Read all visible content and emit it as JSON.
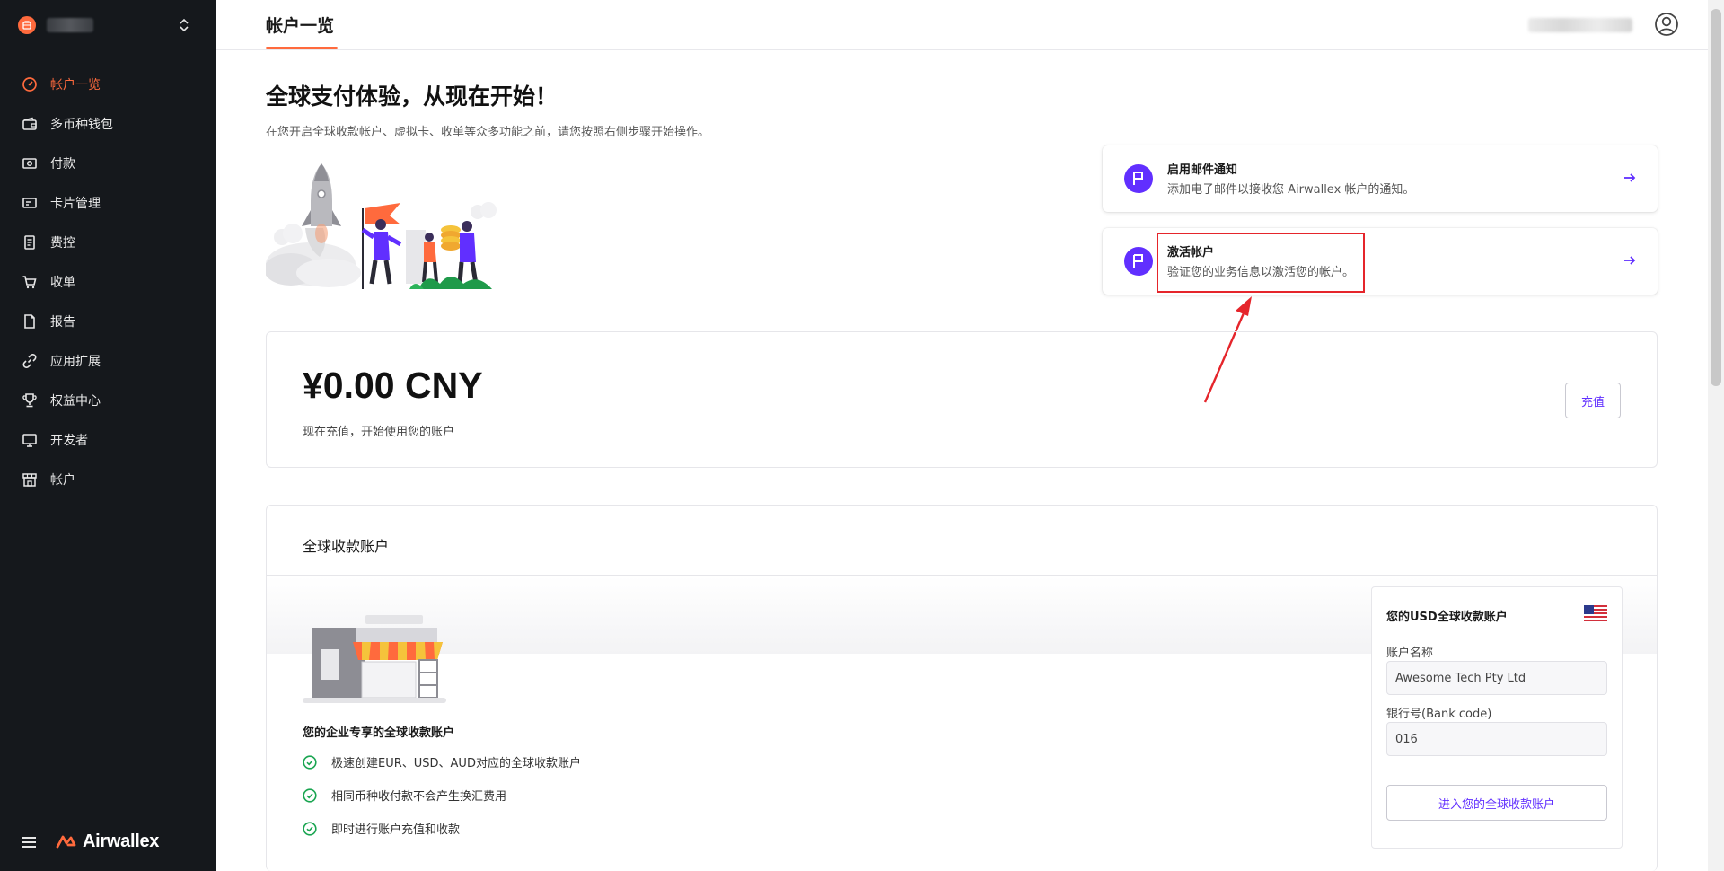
{
  "sidebar": {
    "items": [
      {
        "label": "帐户一览",
        "icon": "dashboard-gauge-icon",
        "active": true
      },
      {
        "label": "多币种钱包",
        "icon": "wallet-icon",
        "active": false
      },
      {
        "label": "付款",
        "icon": "payment-banknote-icon",
        "active": false
      },
      {
        "label": "卡片管理",
        "icon": "card-icon",
        "active": false
      },
      {
        "label": "费控",
        "icon": "receipt-icon",
        "active": false
      },
      {
        "label": "收单",
        "icon": "cart-icon",
        "active": false
      },
      {
        "label": "报告",
        "icon": "document-icon",
        "active": false
      },
      {
        "label": "应用扩展",
        "icon": "link-icon",
        "active": false
      },
      {
        "label": "权益中心",
        "icon": "trophy-icon",
        "active": false
      },
      {
        "label": "开发者",
        "icon": "monitor-icon",
        "active": false
      },
      {
        "label": "帐户",
        "icon": "store-icon",
        "active": false
      }
    ],
    "brand_name": "Airwallex"
  },
  "header": {
    "tab_label": "帐户一览"
  },
  "hero": {
    "title": "全球支付体验，从现在开始！",
    "subtitle": "在您开启全球收款帐户、虚拟卡、收单等众多功能之前，请您按照右侧步骤开始操作。"
  },
  "tasks": [
    {
      "title": "启用邮件通知",
      "description": "添加电子邮件以接收您 Airwallex 帐户的通知。"
    },
    {
      "title": "激活帐户",
      "description": "验证您的业务信息以激活您的帐户。"
    }
  ],
  "balance": {
    "amount": "¥0.00 CNY",
    "subtitle": "现在充值，开始使用您的账户",
    "topup_label": "充值"
  },
  "global_account": {
    "title": "全球收款账户",
    "subtitle": "您的企业专享的全球收款账户",
    "features": [
      "极速创建EUR、USD、AUD对应的全球收款账户",
      "相同币种收付款不会产生换汇费用",
      "即时进行账户充值和收款"
    ],
    "panel": {
      "title": "您的USD全球收款账户",
      "account_name_label": "账户名称",
      "account_name_value": "Awesome Tech Pty Ltd",
      "bank_code_label": "银行号(Bank code)",
      "bank_code_value": "016",
      "enter_button_label": "进入您的全球收款账户"
    }
  },
  "colors": {
    "accent_orange": "#ff6a3d",
    "accent_purple": "#612fff",
    "sidebar_bg": "#15181c",
    "highlight_red": "#e5252b",
    "check_green": "#1aa551"
  }
}
